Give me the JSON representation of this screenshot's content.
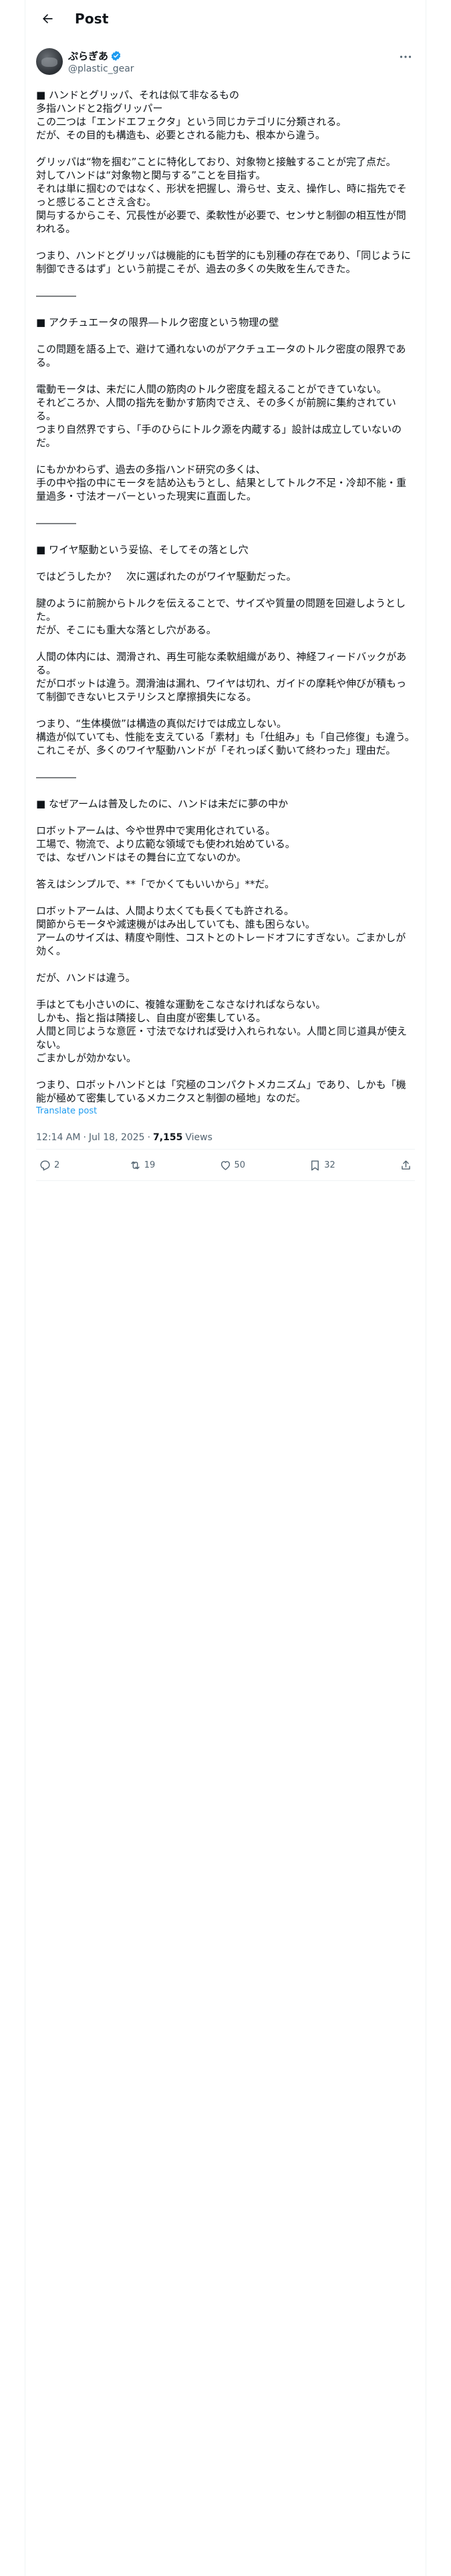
{
  "header": {
    "title": "Post"
  },
  "author": {
    "display_name": "ぷらぎあ",
    "handle": "@plastic_gear"
  },
  "post": {
    "lines": [
      "■ ハンドとグリッパ、それは似て非なるもの",
      "多指ハンドと2指グリッパー",
      "この二つは「エンドエフェクタ」という同じカテゴリに分類される。",
      "だが、その目的も構造も、必要とされる能力も、根本から違う。",
      "",
      "グリッパは“物を掴む”ことに特化しており、対象物と接触することが完了点だ。",
      "対してハンドは“対象物と関与する”ことを目指す。",
      "それは単に掴むのではなく、形状を把握し、滑らせ、支え、操作し、時に指先でそっと感じることさえ含む。",
      "関与するからこそ、冗長性が必要で、柔軟性が必要で、センサと制御の相互性が問われる。",
      "",
      "つまり、ハンドとグリッパは機能的にも哲学的にも別種の存在であり、「同じように制御できるはず」という前提こそが、過去の多くの失敗を生んできた。",
      "",
      "――――",
      "",
      "■ アクチュエータの限界―トルク密度という物理の壁",
      "",
      "この問題を語る上で、避けて通れないのがアクチュエータのトルク密度の限界である。",
      "",
      "電動モータは、未だに人間の筋肉のトルク密度を超えることができていない。",
      "それどころか、人間の指先を動かす筋肉でさえ、その多くが前腕に集約されている。",
      "つまり自然界ですら、「手のひらにトルク源を内蔵する」設計は成立していないのだ。",
      "",
      "にもかかわらず、過去の多指ハンド研究の多くは、",
      "手の中や指の中にモータを詰め込もうとし、結果としてトルク不足・冷却不能・重量過多・寸法オーバーといった現実に直面した。",
      "",
      "――――",
      "",
      "■ ワイヤ駆動という妥協、そしてその落とし穴",
      "",
      "ではどうしたか？　次に選ばれたのがワイヤ駆動だった。",
      "",
      "腱のように前腕からトルクを伝えることで、サイズや質量の問題を回避しようとした。",
      "だが、そこにも重大な落とし穴がある。",
      "",
      "人間の体内には、潤滑され、再生可能な柔軟組織があり、神経フィードバックがある。",
      "だがロボットは違う。潤滑油は漏れ、ワイヤは切れ、ガイドの摩耗や伸びが積もって制御できないヒステリシスと摩擦損失になる。",
      "",
      "つまり、“生体模倣”は構造の真似だけでは成立しない。",
      "構造が似ていても、性能を支えている「素材」も「仕組み」も「自己修復」も違う。",
      "これこそが、多くのワイヤ駆動ハンドが「それっぽく動いて終わった」理由だ。",
      "",
      "――――",
      "",
      "■ なぜアームは普及したのに、ハンドは未だに夢の中か",
      "",
      "ロボットアームは、今や世界中で実用化されている。",
      "工場で、物流で、より広範な領域でも使われ始めている。",
      "では、なぜハンドはその舞台に立てないのか。",
      "",
      "答えはシンプルで、**「でかくてもいいから」**だ。",
      "",
      "ロボットアームは、人間より太くても長くても許される。",
      "関節からモータや減速機がはみ出していても、誰も困らない。",
      "アームのサイズは、精度や剛性、コストとのトレードオフにすぎない。ごまかしが効く。",
      "",
      "だが、ハンドは違う。",
      "",
      "手はとても小さいのに、複雑な運動をこなさなければならない。",
      "しかも、指と指は隣接し、自由度が密集している。",
      "人間と同じような意匠・寸法でなければ受け入れられない。人間と同じ道具が使えない。",
      "ごまかしが効かない。",
      "",
      "つまり、ロボットハンドとは「究極のコンパクトメカニズム」であり、しかも「機能が極めて密集しているメカニクスと制御の極地」なのだ。"
    ],
    "translate_label": "Translate post"
  },
  "meta": {
    "time": "12:14 AM",
    "date": "Jul 18, 2025",
    "views_count": "7,155",
    "views_label": "Views"
  },
  "actions": {
    "replies": "2",
    "reposts": "19",
    "likes": "50",
    "bookmarks": "32"
  },
  "colors": {
    "accent": "#1d9bf0",
    "secondary_text": "#536471",
    "border": "#eff3f4"
  }
}
